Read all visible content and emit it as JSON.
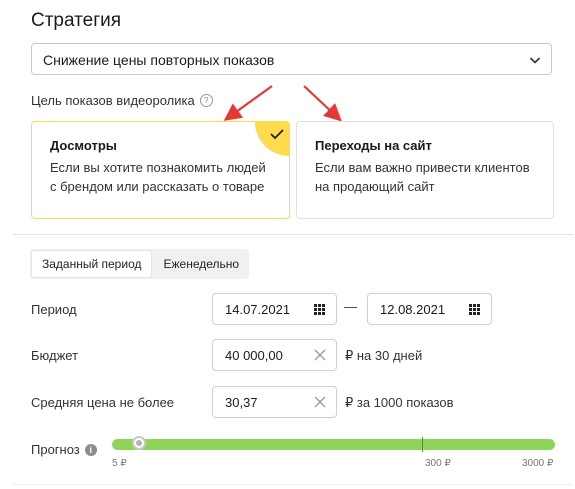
{
  "strategy": {
    "title": "Стратегия",
    "selected": "Снижение цены повторных показов"
  },
  "goal": {
    "label": "Цель показов видеоролика",
    "help_icon": "?",
    "cards": [
      {
        "title": "Досмотры",
        "desc": "Если вы хотите познакомить людей с брендом или рассказать о товаре",
        "selected": true
      },
      {
        "title": "Переходы на сайт",
        "desc": "Если вам важно привести клиентов на продающий сайт",
        "selected": false
      }
    ]
  },
  "period_tabs": [
    "Заданный период",
    "Еженедельно"
  ],
  "period": {
    "label": "Период",
    "start": "14.07.2021",
    "separator": "—",
    "end": "12.08.2021"
  },
  "budget": {
    "label": "Бюджет",
    "value": "40 000,00",
    "suffix": "₽ на 30 дней"
  },
  "avg_price": {
    "label": "Средняя цена не более",
    "value": "30,37",
    "suffix": "₽ за 1000 показов"
  },
  "forecast": {
    "label": "Прогноз",
    "info_icon": "i",
    "min_label": "5 ₽",
    "mid_label": "300 ₽",
    "max_label": "3000 ₽",
    "position_fraction": 0.06
  },
  "colors": {
    "accent_yellow": "#ffdb4d",
    "slider_green": "#8fd45a",
    "arrow_red": "#e53935"
  }
}
